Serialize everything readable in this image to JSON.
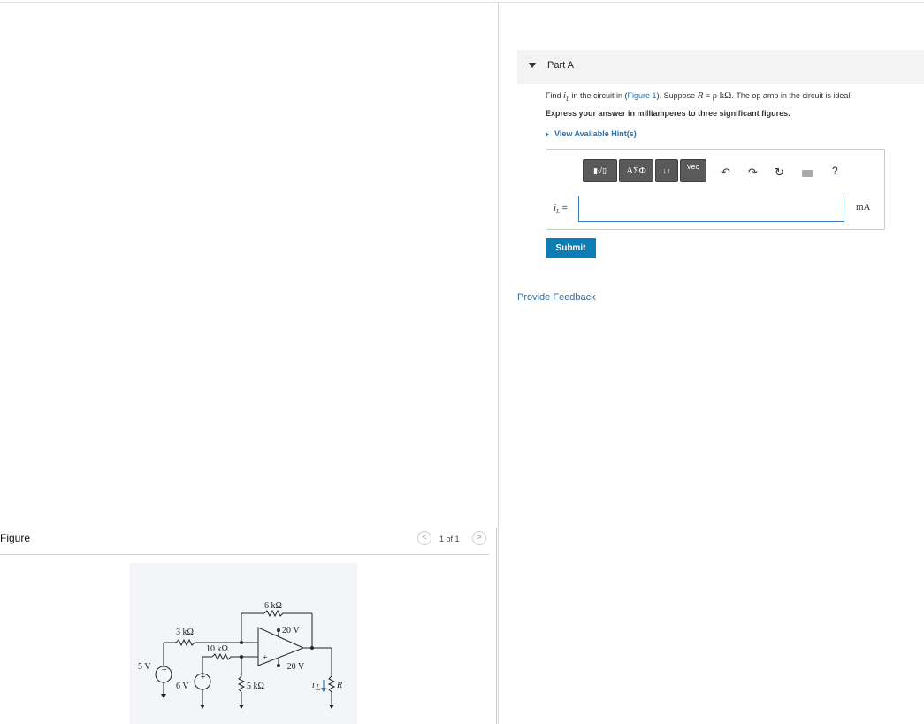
{
  "part": {
    "title": "Part A"
  },
  "question": {
    "find": "Find",
    "var_il": "i",
    "var_il_sub": "L",
    "in_circuit": "in the circuit in (",
    "figure_link": "Figure 1",
    "suppose": "). Suppose",
    "r_var": "R",
    "eq": "=",
    "rho": "ρ",
    "unit": "kΩ",
    "tail": ". The op amp in the circuit is ideal."
  },
  "instruction": "Express your answer in milliamperes to three significant figures.",
  "hints": {
    "label": "View Available Hint(s)"
  },
  "toolbar": {
    "template": "▮√▯",
    "greek": "ΑΣΦ",
    "arrows": "↓↑",
    "vec": "vec",
    "undo": "↶",
    "redo": "↷",
    "reset": "↻",
    "help": "?"
  },
  "answer": {
    "label_var": "i",
    "label_sub": "L",
    "label_eq": "=",
    "value": "",
    "unit": "mA"
  },
  "submit_label": "Submit",
  "feedback_label": "Provide Feedback",
  "figure": {
    "title": "Figure",
    "page": "1 of 1",
    "prev": "<",
    "next": ">",
    "labels": {
      "r6k": "6 kΩ",
      "r3k": "3 kΩ",
      "r10k": "10 kΩ",
      "r5k": "5 kΩ",
      "v20p": "20 V",
      "v20n": "−20 V",
      "v5": "5 V",
      "v6": "6 V",
      "il": "i",
      "il_sub": "L",
      "r": "R"
    }
  }
}
